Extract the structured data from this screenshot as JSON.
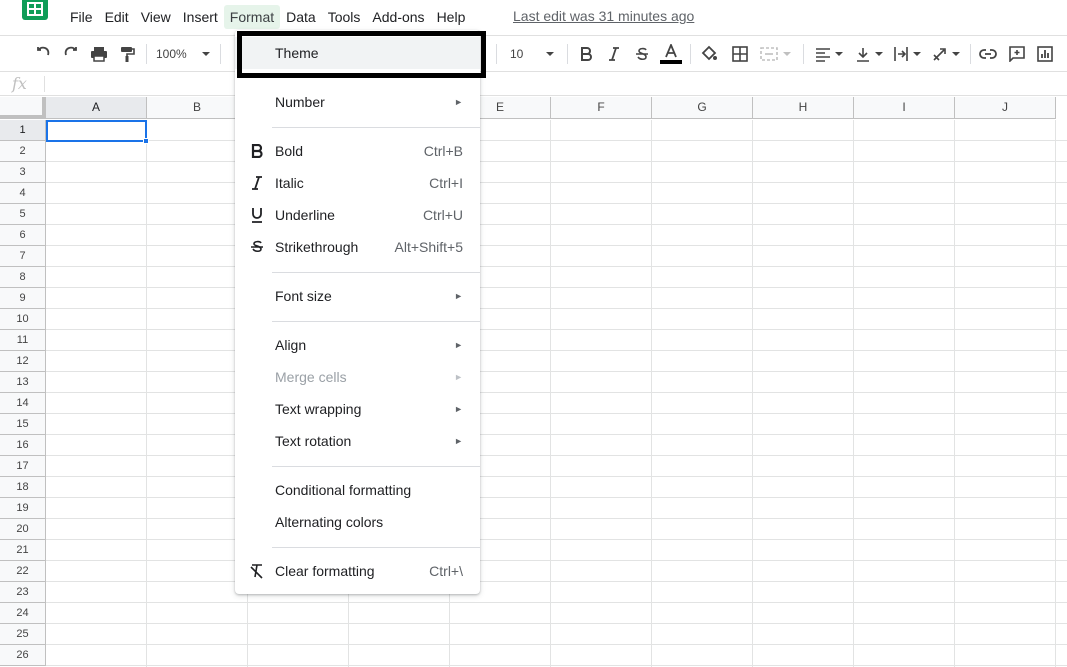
{
  "menubar": {
    "items": [
      "File",
      "Edit",
      "View",
      "Insert",
      "Format",
      "Data",
      "Tools",
      "Add-ons",
      "Help"
    ],
    "active_index": 4,
    "last_edit": "Last edit was 31 minutes ago"
  },
  "toolbar": {
    "zoom": "100%",
    "font_size": "10",
    "text_color": "#000000"
  },
  "formula_bar": {
    "fx_label": "fx",
    "value": ""
  },
  "sheet": {
    "columns": [
      "A",
      "B",
      "C",
      "D",
      "E",
      "F",
      "G",
      "H",
      "I",
      "J"
    ],
    "rows": [
      "1",
      "2",
      "3",
      "4",
      "5",
      "6",
      "7",
      "8",
      "9",
      "10",
      "11",
      "12",
      "13",
      "14",
      "15",
      "16",
      "17",
      "18",
      "19",
      "20",
      "21",
      "22",
      "23",
      "24",
      "25",
      "26"
    ],
    "active_cell": "A1"
  },
  "format_menu": {
    "theme": "Theme",
    "number": "Number",
    "bold": {
      "label": "Bold",
      "shortcut": "Ctrl+B"
    },
    "italic": {
      "label": "Italic",
      "shortcut": "Ctrl+I"
    },
    "underline": {
      "label": "Underline",
      "shortcut": "Ctrl+U"
    },
    "strikethrough": {
      "label": "Strikethrough",
      "shortcut": "Alt+Shift+5"
    },
    "font_size": "Font size",
    "align": "Align",
    "merge_cells": "Merge cells",
    "text_wrapping": "Text wrapping",
    "text_rotation": "Text rotation",
    "conditional_formatting": "Conditional formatting",
    "alternating_colors": "Alternating colors",
    "clear_formatting": {
      "label": "Clear formatting",
      "shortcut": "Ctrl+\\"
    },
    "submenu_arrow": "►"
  },
  "colors": {
    "brand": "#0f9d58",
    "selection": "#1a73e8",
    "highlight_outline": "#000000"
  }
}
